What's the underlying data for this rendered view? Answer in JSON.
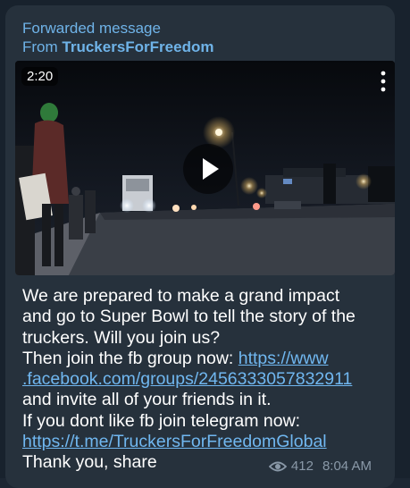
{
  "message": {
    "forwarded_label": "Forwarded message",
    "from_prefix": "From ",
    "from_name": "TruckersForFreedom",
    "video": {
      "duration": "2:20",
      "more_icon": "more-vertical-icon",
      "play_icon": "play-icon"
    },
    "text": {
      "line1": "We are prepared to make a grand impact",
      "line2": "and go to Super Bowl to tell the story of the",
      "line3": "truckers. Will you join us?",
      "line4": "Then join the fb group now: ",
      "link1_part1": "https://www",
      "link1_part2": ".facebook.com/groups/2456333057832911",
      "line5": "and invite all of your friends in it.",
      "line6": "If you dont like fb join telegram now:",
      "link2": "https://t.me/TruckersForFreedomGlobal",
      "line7": "Thank you, share"
    },
    "views_icon": "eye-icon",
    "views": "412",
    "time": "8:04 AM"
  },
  "colors": {
    "bubble": "#26313c",
    "link": "#70b7f0",
    "header": "#6fb3e8",
    "meta": "#8a99a8"
  }
}
